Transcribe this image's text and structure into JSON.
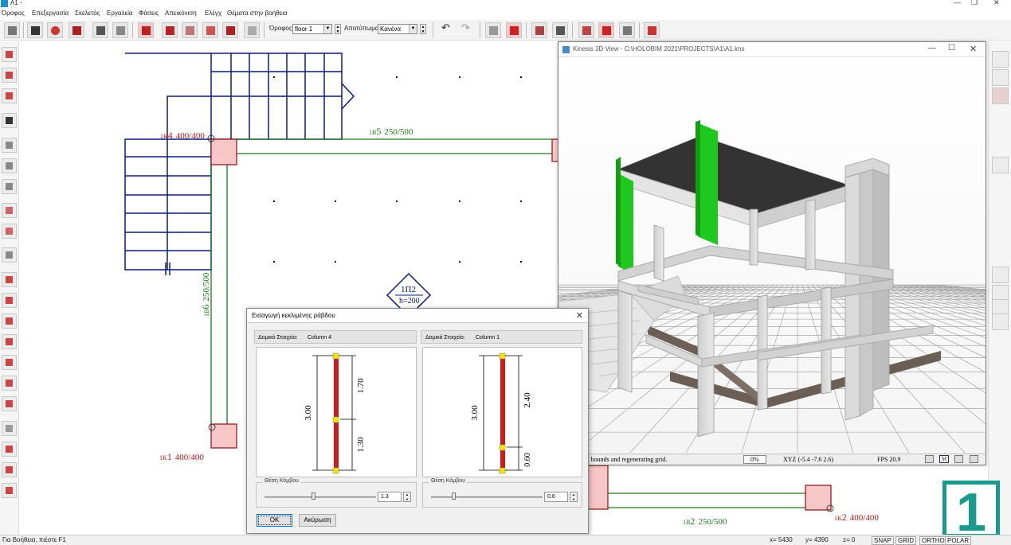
{
  "window": {
    "title": "A1 -"
  },
  "menu": [
    "Όροφος",
    "Επεξεργασία",
    "Σκελετός",
    "Εργαλεία",
    "Φάσεις",
    "Απεικόνιση",
    "Ελέγχ",
    "Θέματα στην βοήθεια"
  ],
  "toolbar": {
    "floor_label": "Όροφος",
    "floor_value": "floor 1",
    "result_label": "Αποτύπωμα",
    "result_value": "Κανένα"
  },
  "cad": {
    "column_k4": {
      "prefix": "1K",
      "num": "4",
      "dim": "400/400"
    },
    "column_k1": {
      "prefix": "1K",
      "num": "1",
      "dim": "400/400"
    },
    "column_k2": {
      "prefix": "1K",
      "num": "2",
      "dim": "400/400"
    },
    "beam_b5": {
      "prefix": "1B",
      "num": "5",
      "dim": "250/500"
    },
    "beam_b6": {
      "prefix": "1B",
      "num": "6",
      "dim": "250/500"
    },
    "beam_b2": {
      "prefix": "1B",
      "num": "2",
      "dim": "250/500"
    },
    "slab": {
      "name": "1Π2",
      "thickness": "h=200"
    }
  },
  "view3d": {
    "title": "Kinesis 3D View - C:\\HOLOBIM 2021\\PROJECTS\\A1\\A1.kns",
    "status_msg": "ating world bounds and regenerating grid.",
    "percent": "0%",
    "xyz": "XYZ (-5.4 -7.6 2.6)",
    "fps": "FPS 20.9",
    "m_button": "M"
  },
  "dialog": {
    "title": "Εισαγωγή κεκλιμένης ράβδου",
    "left": {
      "element_label": "Δομικό Στοιχείο:",
      "element_value": "Column 4",
      "total": "3.00",
      "upper": "1.70",
      "lower": "1.30",
      "node_label": "Θέση Κόμβου",
      "node_value": "1.3",
      "node_fraction": 0.433
    },
    "right": {
      "element_label": "Δομικό Στοιχείο:",
      "element_value": "Column 1",
      "total": "3.00",
      "upper": "2.40",
      "lower": "0.60",
      "node_label": "Θέση Κόμβου",
      "node_value": "0.6",
      "node_fraction": 0.2
    },
    "ok": "OK",
    "cancel": "Ακύρωση"
  },
  "status": {
    "help": "Για Βοήθεια, πιέστε F1",
    "x": "x= 5430",
    "y": "y= 4390",
    "z": "z= 0",
    "snap": "SNAP",
    "grid": "GRID",
    "ortho": "ORTHO",
    "polar": "POLAR"
  },
  "badge": "1",
  "colors": {
    "accent": "#1a9a8c",
    "column": "#c01818",
    "beam": "#1c7a1c",
    "stair": "#0a1a7a",
    "green_column": "#1ec81e"
  }
}
